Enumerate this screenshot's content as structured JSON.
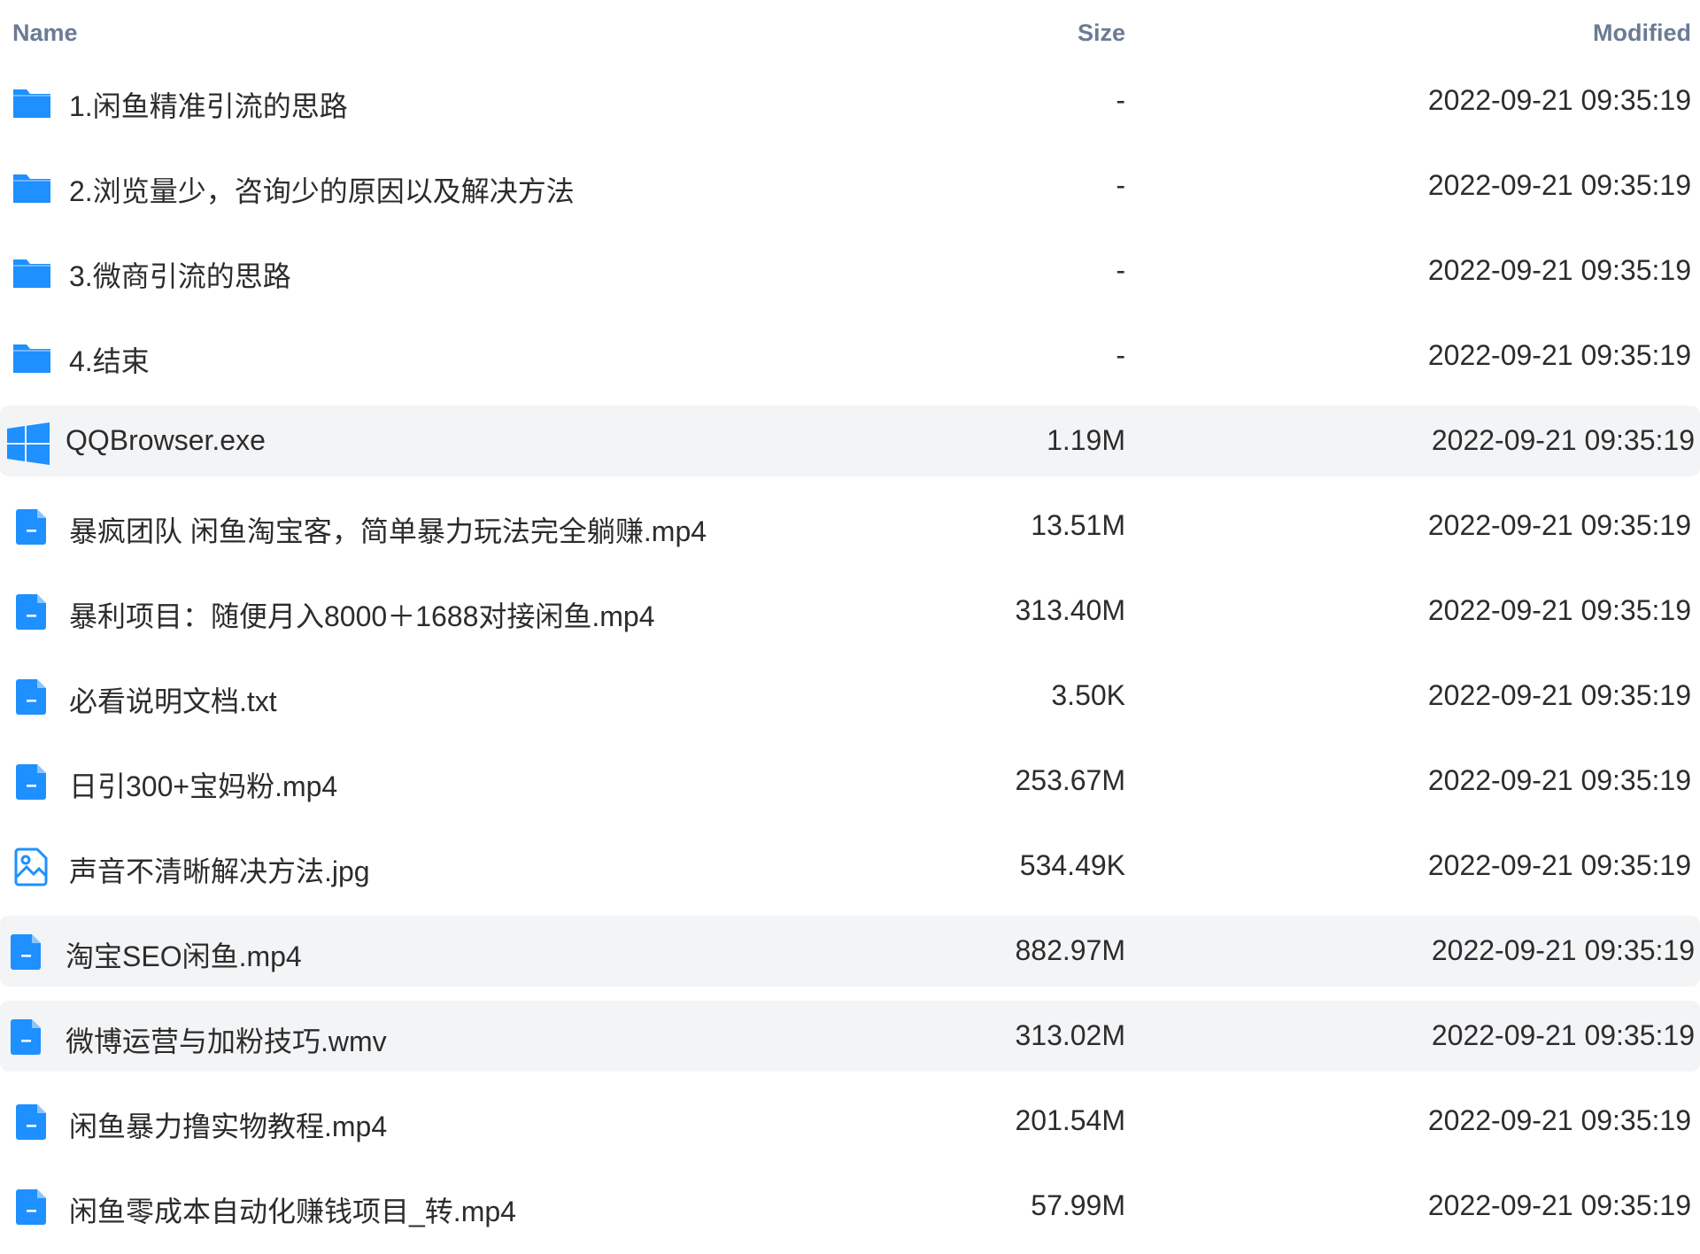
{
  "header": {
    "name_label": "Name",
    "size_label": "Size",
    "modified_label": "Modified"
  },
  "colors": {
    "accent": "#1e90ff",
    "header_text": "#6b7b93",
    "row_highlight": "#f3f4f6"
  },
  "files": [
    {
      "icon": "folder-icon",
      "name": "1.闲鱼精准引流的思路",
      "size": "-",
      "modified": "2022-09-21 09:35:19",
      "highlighted": false
    },
    {
      "icon": "folder-icon",
      "name": "2.浏览量少，咨询少的原因以及解决方法",
      "size": "-",
      "modified": "2022-09-21 09:35:19",
      "highlighted": false
    },
    {
      "icon": "folder-icon",
      "name": "3.微商引流的思路",
      "size": "-",
      "modified": "2022-09-21 09:35:19",
      "highlighted": false
    },
    {
      "icon": "folder-icon",
      "name": "4.结束",
      "size": "-",
      "modified": "2022-09-21 09:35:19",
      "highlighted": false
    },
    {
      "icon": "windows-icon",
      "name": "QQBrowser.exe",
      "size": "1.19M",
      "modified": "2022-09-21 09:35:19",
      "highlighted": true
    },
    {
      "icon": "file-icon",
      "name": "暴疯团队 闲鱼淘宝客，简单暴力玩法完全躺赚.mp4",
      "size": "13.51M",
      "modified": "2022-09-21 09:35:19",
      "highlighted": false
    },
    {
      "icon": "file-icon",
      "name": "暴利项目：随便月入8000＋1688对接闲鱼.mp4",
      "size": "313.40M",
      "modified": "2022-09-21 09:35:19",
      "highlighted": false
    },
    {
      "icon": "file-icon",
      "name": "必看说明文档.txt",
      "size": "3.50K",
      "modified": "2022-09-21 09:35:19",
      "highlighted": false
    },
    {
      "icon": "file-icon",
      "name": "日引300+宝妈粉.mp4",
      "size": "253.67M",
      "modified": "2022-09-21 09:35:19",
      "highlighted": false
    },
    {
      "icon": "image-file-icon",
      "name": "声音不清晰解决方法.jpg",
      "size": "534.49K",
      "modified": "2022-09-21 09:35:19",
      "highlighted": false
    },
    {
      "icon": "file-icon",
      "name": "淘宝SEO闲鱼.mp4",
      "size": "882.97M",
      "modified": "2022-09-21 09:35:19",
      "highlighted": true
    },
    {
      "icon": "file-icon",
      "name": "微博运营与加粉技巧.wmv",
      "size": "313.02M",
      "modified": "2022-09-21 09:35:19",
      "highlighted": true
    },
    {
      "icon": "file-icon",
      "name": "闲鱼暴力撸实物教程.mp4",
      "size": "201.54M",
      "modified": "2022-09-21 09:35:19",
      "highlighted": false
    },
    {
      "icon": "file-icon",
      "name": "闲鱼零成本自动化赚钱项目_转.mp4",
      "size": "57.99M",
      "modified": "2022-09-21 09:35:19",
      "highlighted": false
    }
  ]
}
